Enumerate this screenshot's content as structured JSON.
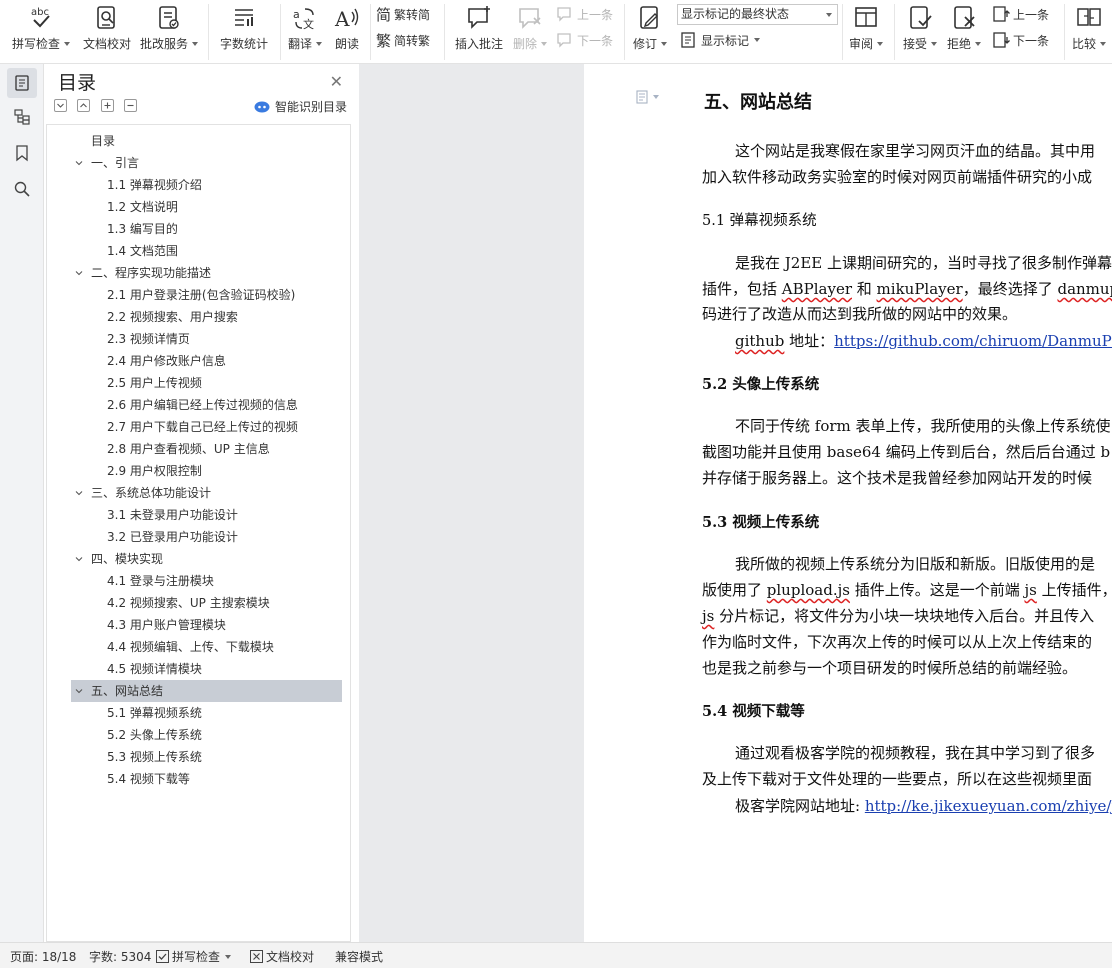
{
  "ribbon": {
    "spellcheck": "拼写检查",
    "doc_proof": "文档校对",
    "batch_service": "批改服务",
    "word_count": "字数统计",
    "translate": "翻译",
    "read_aloud": "朗读",
    "trad_convert": "繁转简",
    "simp_convert": "简转繁",
    "insert_comment": "插入批注",
    "delete": "删除",
    "prev_comment": "上一条",
    "next_comment": "下一条",
    "track_changes": "修订",
    "markup_state": "显示标记的最终状态",
    "show_markup": "显示标记",
    "review": "审阅",
    "accept": "接受",
    "reject": "拒绝",
    "prev_change": "上一条",
    "next_change": "下一条",
    "compare": "比较"
  },
  "toc": {
    "title": "目录",
    "smart_label": "智能识别目录",
    "items": [
      {
        "label": "目录"
      },
      {
        "label": "一、引言"
      },
      {
        "label": "1.1 弹幕视频介绍"
      },
      {
        "label": "1.2 文档说明"
      },
      {
        "label": "1.3 编写目的"
      },
      {
        "label": "1.4 文档范围"
      },
      {
        "label": "二、程序实现功能描述"
      },
      {
        "label": "2.1 用户登录注册(包含验证码校验)"
      },
      {
        "label": "2.2 视频搜索、用户搜索"
      },
      {
        "label": "2.3 视频详情页"
      },
      {
        "label": "2.4 用户修改账户信息"
      },
      {
        "label": "2.5 用户上传视频"
      },
      {
        "label": "2.6 用户编辑已经上传过视频的信息"
      },
      {
        "label": "2.7 用户下载自己已经上传过的视频"
      },
      {
        "label": "2.8 用户查看视频、UP 主信息"
      },
      {
        "label": "2.9 用户权限控制"
      },
      {
        "label": "三、系统总体功能设计"
      },
      {
        "label": "3.1 未登录用户功能设计"
      },
      {
        "label": "3.2 已登录用户功能设计"
      },
      {
        "label": "四、模块实现"
      },
      {
        "label": "4.1 登录与注册模块"
      },
      {
        "label": "4.2 视频搜索、UP 主搜索模块"
      },
      {
        "label": "4.3 用户账户管理模块"
      },
      {
        "label": "4.4 视频编辑、上传、下载模块"
      },
      {
        "label": "4.5 视频详情模块"
      },
      {
        "label": "五、网站总结"
      },
      {
        "label": "5.1 弹幕视频系统"
      },
      {
        "label": "5.2 头像上传系统"
      },
      {
        "label": "5.3 视频上传系统"
      },
      {
        "label": "5.4 视频下载等"
      }
    ]
  },
  "document": {
    "heading": "五、网站总结",
    "intro_1": "这个网站是我寒假在家里学习网页汗血的结晶。其中用",
    "intro_2": "加入软件移动政务实验室的时候对网页前端插件研究的小成",
    "s51_title": "5.1 弹幕视频系统",
    "s51_p1": "是我在 J2EE 上课期间研究的，当时寻找了很多制作弹幕",
    "s51_p2a": "插件，包括 ",
    "s51_abplayer": "ABPlayer",
    "s51_p2b": " 和 ",
    "s51_miku": "mikuPlayer",
    "s51_p2c": "，最终选择了 ",
    "s51_danmu": "danmuplay",
    "s51_p3": "码进行了改造从而达到我所做的网站中的效果。",
    "s51_github_pre": "github",
    "s51_github_label": " 地址：",
    "s51_github_url": "https://github.com/chiruom/DanmuPlayer/",
    "s52_title": "5.2 头像上传系统",
    "s52_p1": "不同于传统 form 表单上传，我所使用的头像上传系统使",
    "s52_p2": "截图功能并且使用 base64 编码上传到后台，然后后台通过 b",
    "s52_p3": "并存储于服务器上。这个技术是我曾经参加网站开发的时候",
    "s53_title": "5.3 视频上传系统",
    "s53_p1": "我所做的视频上传系统分为旧版和新版。旧版使用的是",
    "s53_p2a": "版使用了 ",
    "s53_plupload": "plupload.js",
    "s53_p2b": " 插件上传。这是一个前端 ",
    "s53_js": "js",
    "s53_p2c": " 上传插件，",
    "s53_p3a": "js",
    "s53_p3b": " 分片标记，将文件分为小块一块块地传入后台。并且传入",
    "s53_p4": "作为临时文件，下次再次上传的时候可以从上次上传结束的",
    "s53_p5": "也是我之前参与一个项目研发的时候所总结的前端经验。",
    "s54_title": "5.4 视频下载等",
    "s54_p1": "通过观看极客学院的视频教程，我在其中学习到了很多",
    "s54_p2": "及上传下载对于文件处理的一些要点，所以在这些视频里面",
    "s54_site_label": "极客学院网站地址: ",
    "s54_site_url": "http://ke.jikexueyuan.com/zhiye/javaw"
  },
  "status": {
    "page": "页面: 18/18",
    "words": "字数: 5304",
    "spellcheck": "拼写检查",
    "doc_proof": "文档校对",
    "compat": "兼容模式"
  }
}
